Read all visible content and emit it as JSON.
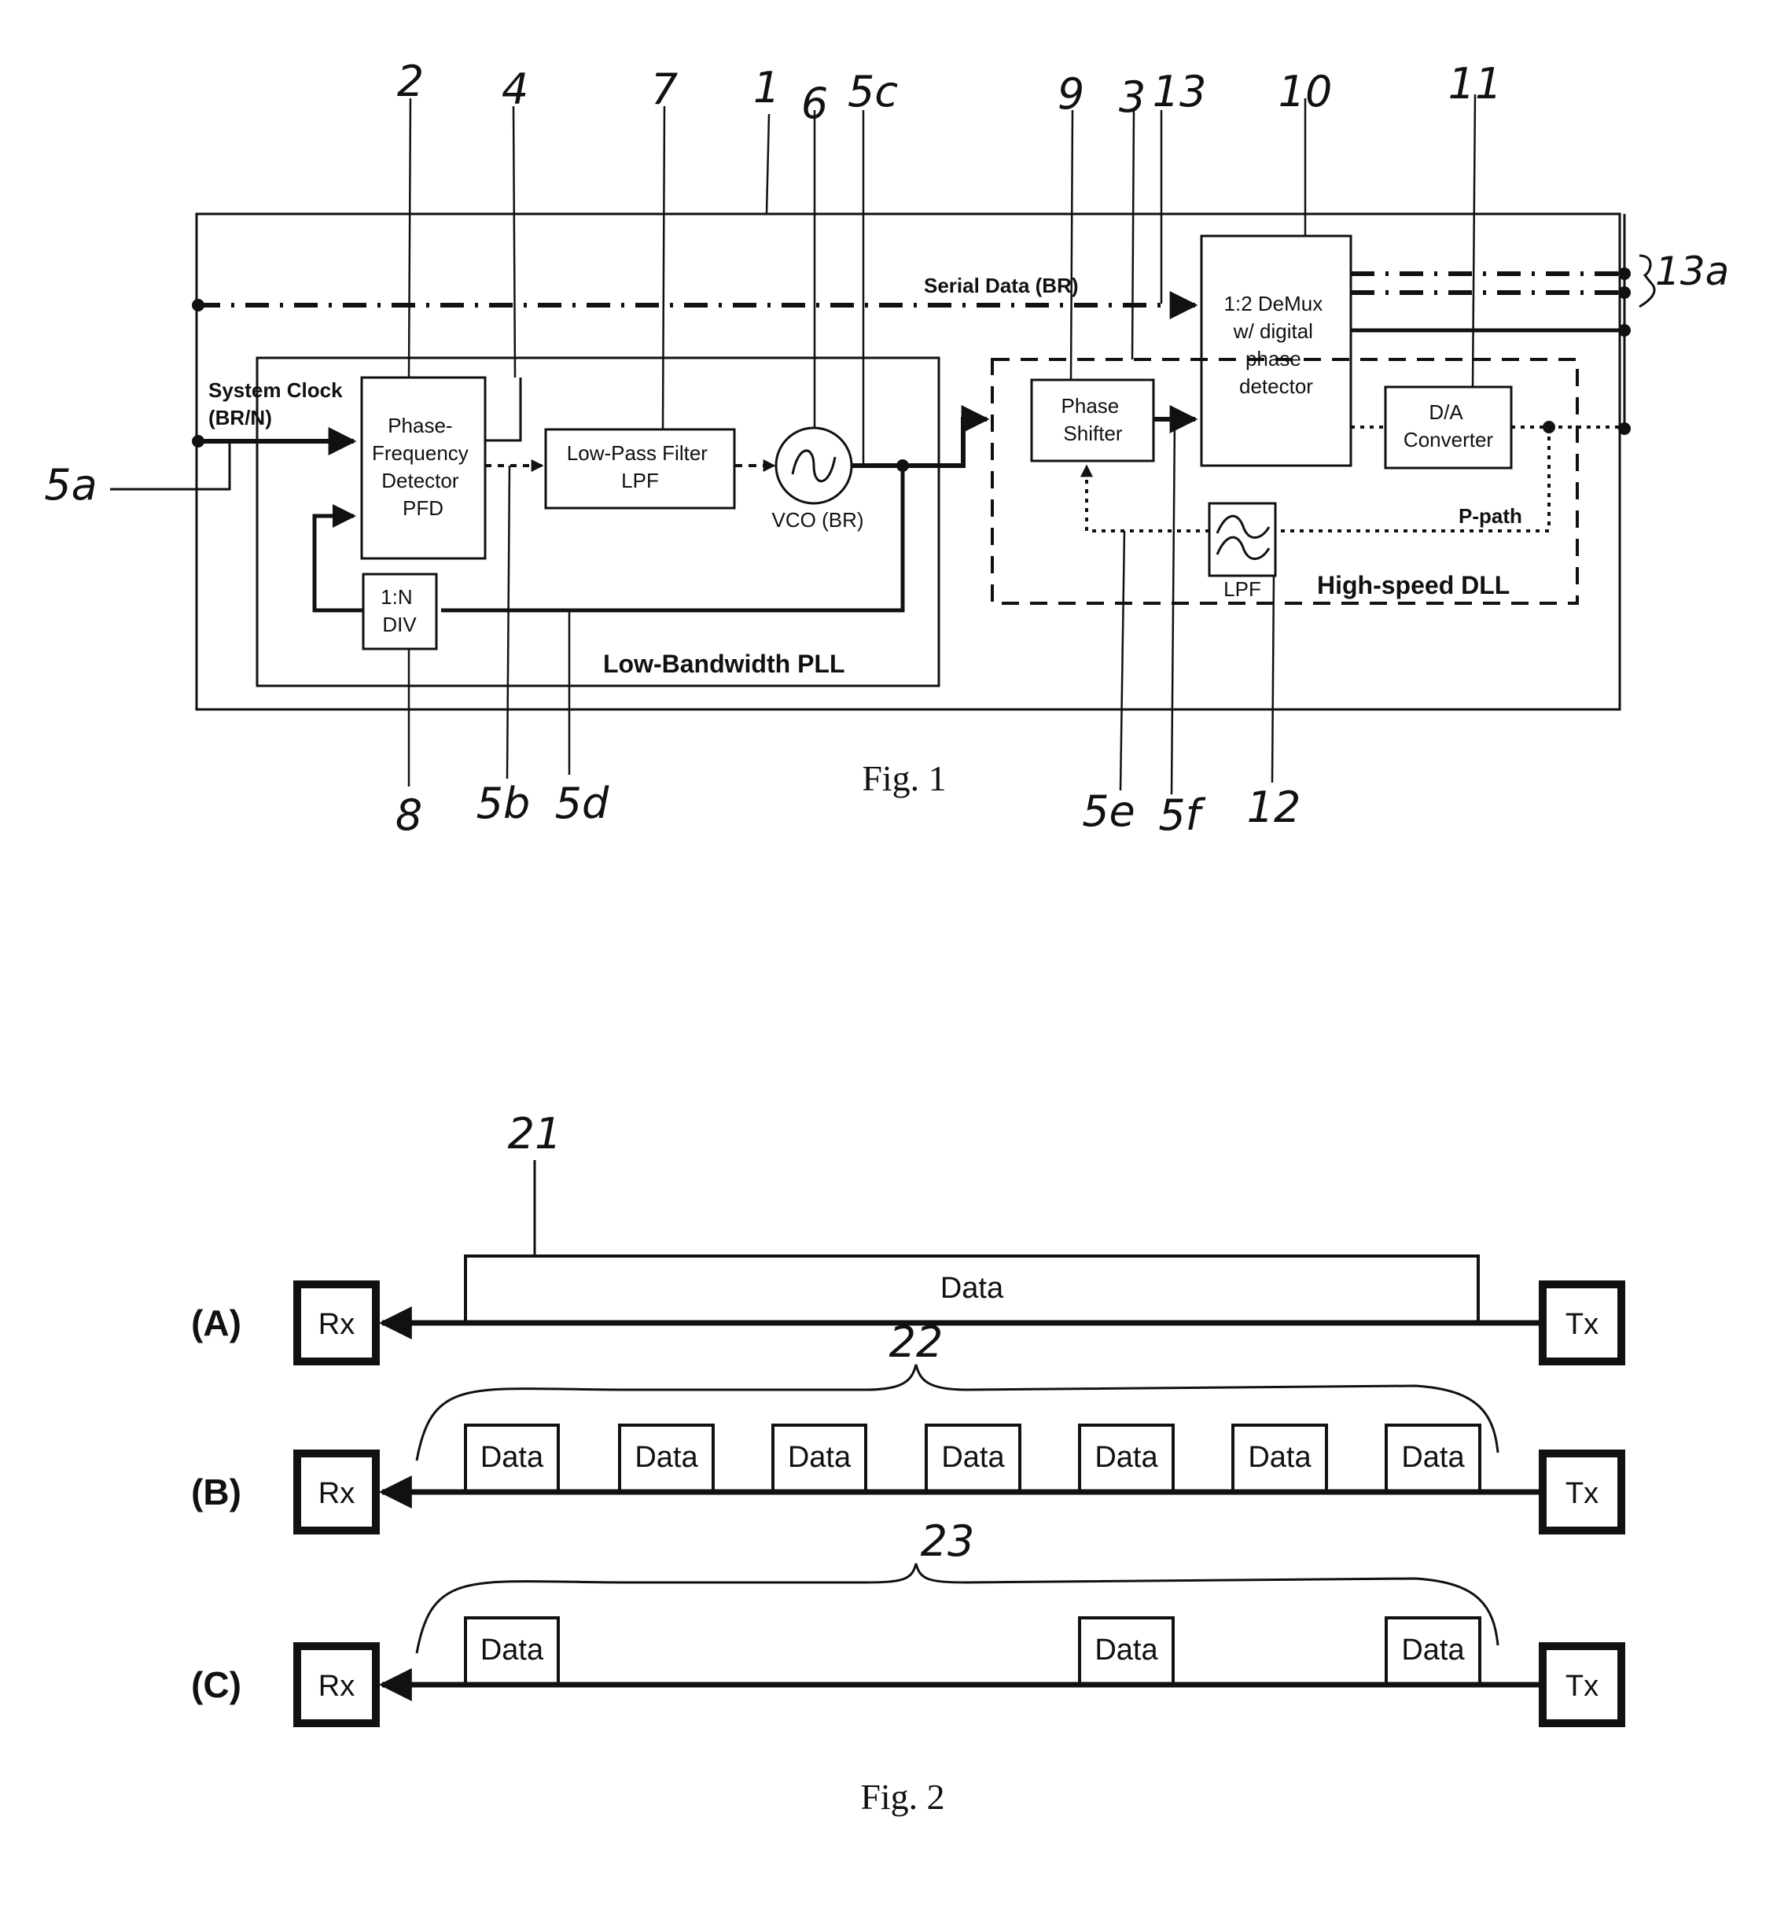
{
  "fig1": {
    "caption": "Fig. 1",
    "signals": {
      "serial_data": "Serial Data (BR)",
      "system_clock_line1": "System Clock",
      "system_clock_line2": "(BR/N)",
      "p_path": "P-path"
    },
    "blocks": {
      "pfd": [
        "Phase-",
        "Frequency",
        "Detector",
        "PFD"
      ],
      "lpf": [
        "Low-Pass Filter",
        "LPF"
      ],
      "vco": "VCO (BR)",
      "div": [
        "1:N",
        "DIV"
      ],
      "phase_shifter": [
        "Phase",
        "Shifter"
      ],
      "demux": [
        "1:2 DeMux",
        "w/ digital",
        "phase",
        "detector"
      ],
      "dac": [
        "D/A",
        "Converter"
      ],
      "dll_lpf": "LPF"
    },
    "regions": {
      "pll": "Low-Bandwidth PLL",
      "dll": "High-speed DLL"
    },
    "ref_numerals": {
      "n1": "1",
      "n2": "2",
      "n3": "3",
      "n4": "4",
      "n5a": "5a",
      "n5b": "5b",
      "n5c": "5c",
      "n5d": "5d",
      "n5e": "5e",
      "n5f": "5f",
      "n6": "6",
      "n7": "7",
      "n8": "8",
      "n9": "9",
      "n10": "10",
      "n11": "11",
      "n12": "12",
      "n13": "13",
      "n13a": "13a"
    }
  },
  "fig2": {
    "caption": "Fig. 2",
    "rows": [
      {
        "label": "(A)",
        "rx": "Rx",
        "tx": "Tx",
        "packets": [
          "Data"
        ],
        "ref": "21"
      },
      {
        "label": "(B)",
        "rx": "Rx",
        "tx": "Tx",
        "packets": [
          "Data",
          "Data",
          "Data",
          "Data",
          "Data",
          "Data",
          "Data"
        ],
        "ref": "22"
      },
      {
        "label": "(C)",
        "rx": "Rx",
        "tx": "Tx",
        "packets": [
          "Data",
          "Data",
          "Data"
        ],
        "ref": "23"
      }
    ]
  }
}
